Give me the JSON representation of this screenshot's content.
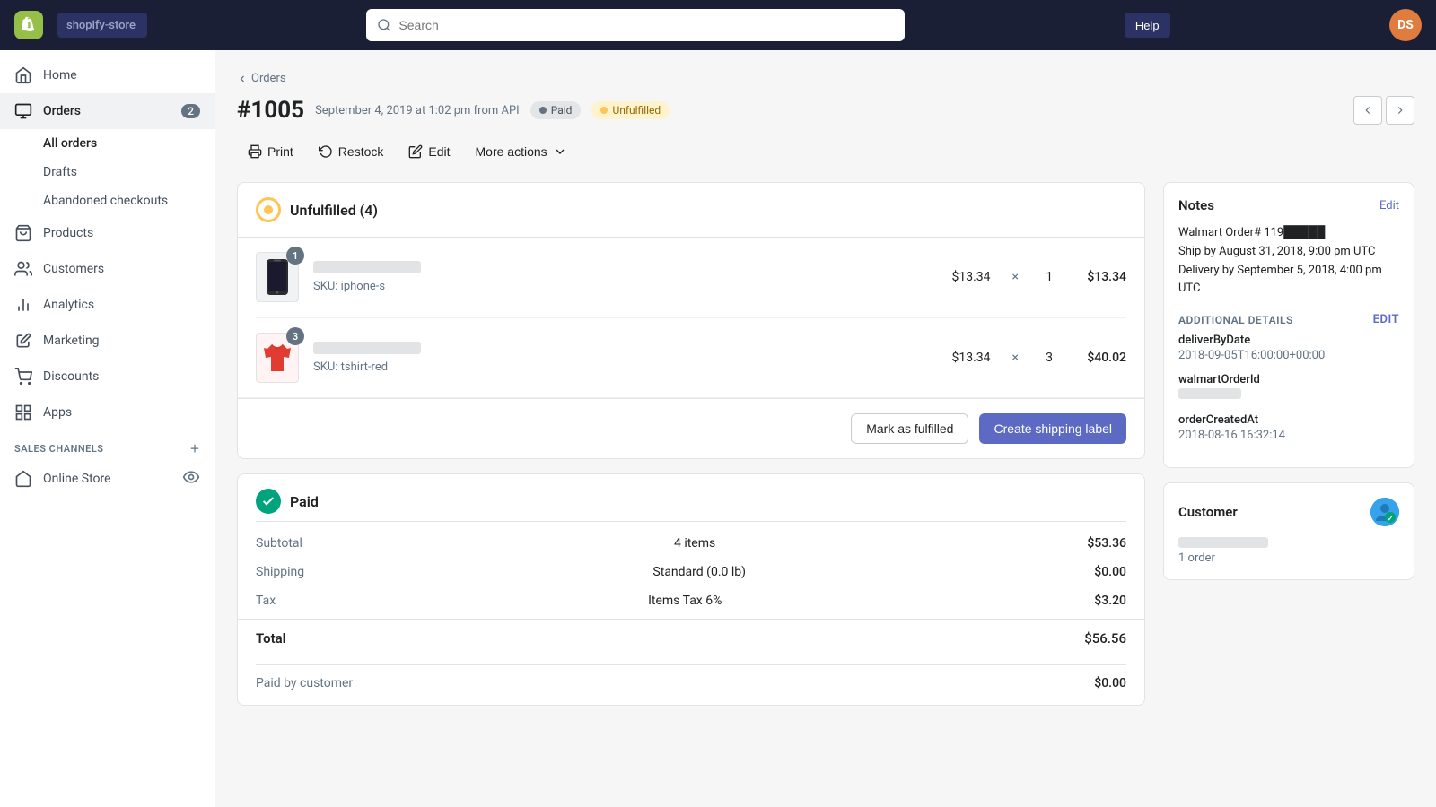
{
  "topnav": {
    "store_name": "shopify-store",
    "search_placeholder": "Search",
    "avatar_initials": "DS",
    "help_label": "Help"
  },
  "sidebar": {
    "items": [
      {
        "id": "home",
        "label": "Home",
        "icon": "home-icon"
      },
      {
        "id": "orders",
        "label": "Orders",
        "icon": "orders-icon",
        "badge": "2"
      },
      {
        "id": "products",
        "label": "Products",
        "icon": "products-icon"
      },
      {
        "id": "customers",
        "label": "Customers",
        "icon": "customers-icon"
      },
      {
        "id": "analytics",
        "label": "Analytics",
        "icon": "analytics-icon"
      },
      {
        "id": "marketing",
        "label": "Marketing",
        "icon": "marketing-icon"
      },
      {
        "id": "discounts",
        "label": "Discounts",
        "icon": "discounts-icon"
      },
      {
        "id": "apps",
        "label": "Apps",
        "icon": "apps-icon"
      }
    ],
    "orders_sub": [
      {
        "id": "all-orders",
        "label": "All orders",
        "active": true
      },
      {
        "id": "drafts",
        "label": "Drafts"
      },
      {
        "id": "abandoned",
        "label": "Abandoned checkouts"
      }
    ],
    "sales_channels_title": "SALES CHANNELS",
    "sales_channels": [
      {
        "id": "online-store",
        "label": "Online Store",
        "icon": "store-icon"
      }
    ]
  },
  "breadcrumb": "Orders",
  "page": {
    "order_number": "#1005",
    "subtitle": "September 4, 2019 at 1:02 pm from API",
    "status_paid": "Paid",
    "status_fulfilled": "Unfulfilled",
    "nav_prev": "←",
    "nav_next": "→"
  },
  "actions": {
    "print": "Print",
    "restock": "Restock",
    "edit": "Edit",
    "more_actions": "More actions"
  },
  "unfulfilled": {
    "title": "Unfulfilled (4)",
    "items": [
      {
        "qty_badge": "1",
        "sku": "SKU: iphone-s",
        "price": "$13.34",
        "qty": "1",
        "total": "$13.34",
        "type": "iphone"
      },
      {
        "qty_badge": "3",
        "sku": "SKU: tshirt-red",
        "price": "$13.34",
        "qty": "3",
        "total": "$40.02",
        "type": "tshirt"
      }
    ],
    "mark_fulfilled": "Mark as fulfilled",
    "create_shipping": "Create shipping label"
  },
  "payment": {
    "title": "Paid",
    "rows": [
      {
        "label": "Subtotal",
        "desc": "4 items",
        "value": "$53.36"
      },
      {
        "label": "Shipping",
        "desc": "Standard (0.0 lb)",
        "value": "$0.00"
      },
      {
        "label": "Tax",
        "desc": "Items Tax 6%",
        "value": "$3.20"
      }
    ],
    "total_label": "Total",
    "total_value": "$56.56",
    "paid_by": "Paid by customer",
    "paid_by_value": "$0.00"
  },
  "notes": {
    "title": "Notes",
    "edit": "Edit",
    "text": "Walmart Order# 119█████\nShip by August 31, 2018, 9:00 pm UTC\nDelivery by September 5, 2018, 4:00 pm UTC"
  },
  "additional": {
    "title": "ADDITIONAL DETAILS",
    "edit": "Edit",
    "fields": [
      {
        "key": "deliverByDate",
        "val": "2018-09-05T16:00:00+00:00"
      },
      {
        "key": "walmartOrderId",
        "val": "████████"
      },
      {
        "key": "orderCreatedAt",
        "val": "2018-08-16 16:32:14"
      }
    ]
  },
  "customer": {
    "title": "Customer",
    "orders": "1 order"
  }
}
